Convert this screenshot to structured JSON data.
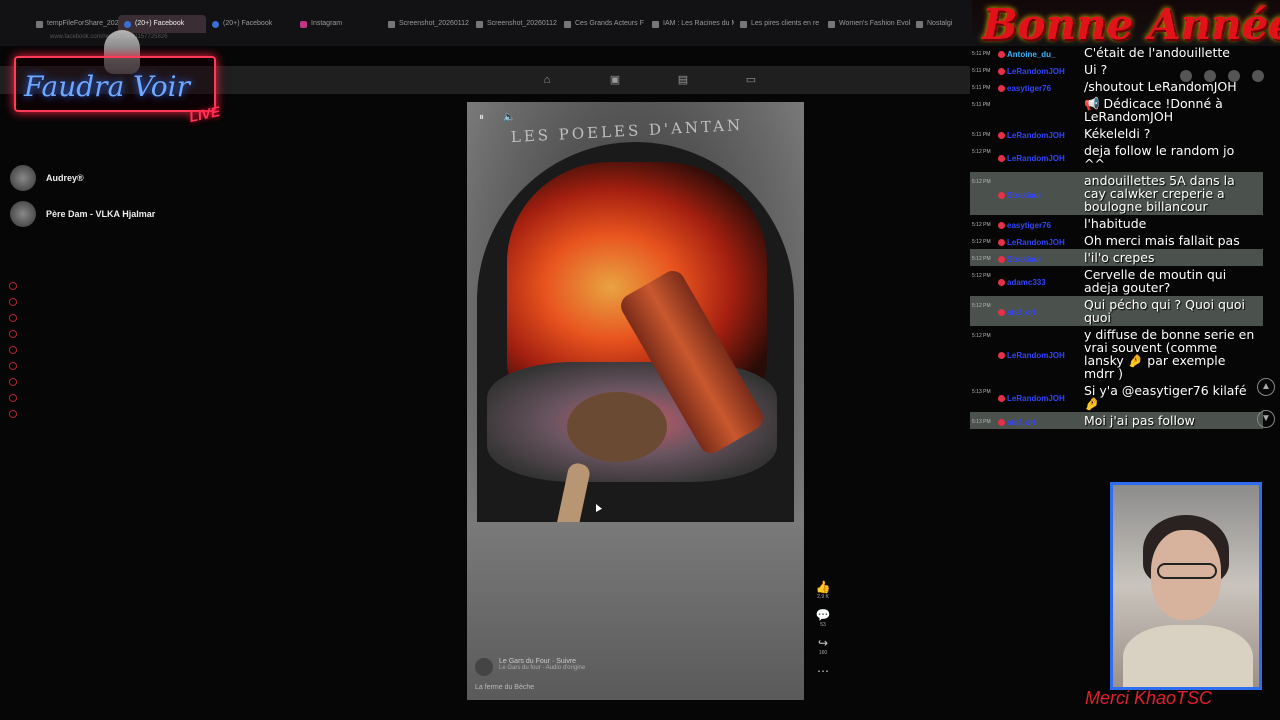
{
  "browser": {
    "tabs": [
      {
        "label": "tempFileForShare_2024",
        "icon": "doc-icon"
      },
      {
        "label": "(20+) Facebook",
        "icon": "facebook-icon",
        "active": true
      },
      {
        "label": "(20+) Facebook",
        "icon": "facebook-icon"
      },
      {
        "label": "Instagram",
        "icon": "instagram-icon"
      },
      {
        "label": "Screenshot_20260112",
        "icon": "doc-icon"
      },
      {
        "label": "Screenshot_20260112",
        "icon": "doc-icon"
      },
      {
        "label": "Ces Grands Acteurs F",
        "icon": "doc-icon"
      },
      {
        "label": "IAM : Les Racines du M",
        "icon": "doc-icon"
      },
      {
        "label": "Les pires clients en re",
        "icon": "doc-icon"
      },
      {
        "label": "Women's Fashion Evol",
        "icon": "doc-icon"
      },
      {
        "label": "Nostalgi",
        "icon": "doc-icon"
      }
    ],
    "url": "www.facebook.com/reel/1176691157725826"
  },
  "overlay": {
    "logo_text": "Faudra Voir",
    "logo_live": "LIVE",
    "banner_text": "Bonne Année",
    "bottom_text": "Merci KhaoTSC"
  },
  "sidebar": {
    "contacts": [
      {
        "name": "Audrey®"
      },
      {
        "name": "Père Dam - VLKA Hjalmar"
      }
    ]
  },
  "video": {
    "brand": "LES POELES D'ANTAN",
    "author": "Le Gars du Four",
    "author_sub": "Le Gars du four · Audio d'origine",
    "follow": "Suivre",
    "caption": "La ferme du Bèche"
  },
  "reactions": [
    {
      "icon": "like-icon",
      "count": "2,9 K"
    },
    {
      "icon": "comment-icon",
      "count": "53"
    },
    {
      "icon": "share-icon",
      "count": "160"
    }
  ],
  "chat": [
    {
      "time": "5:11 PM",
      "user": "Antoine_du_",
      "text": "C'était de l'andouillette",
      "color": "#3ab4ff",
      "highlight": false
    },
    {
      "time": "5:11 PM",
      "user": "LeRandomJOH",
      "text": "Ui ?",
      "color": "#3344ff",
      "highlight": false
    },
    {
      "time": "5:11 PM",
      "user": "easytiger76",
      "text": "/shoutout LeRandomJOH",
      "color": "#3344ff",
      "highlight": false
    },
    {
      "time": "5:11 PM",
      "user": "",
      "text": "📢 Dédicace !Donné à LeRandomJOH",
      "color": "#ffffff",
      "highlight": false
    },
    {
      "time": "5:11 PM",
      "user": "LeRandomJOH",
      "text": "Kékeleldi ?",
      "color": "#3344ff",
      "highlight": false
    },
    {
      "time": "5:12 PM",
      "user": "LeRandomJOH",
      "text": "deja follow le random jo ^^",
      "color": "#3344ff",
      "highlight": false
    },
    {
      "time": "5:12 PM",
      "user": "Strakiaur",
      "text": "andouillettes 5A dans la cay calwker creperie a boulogne billancour",
      "color": "#3344ff",
      "highlight": true
    },
    {
      "time": "5:12 PM",
      "user": "easytiger76",
      "text": "l'habitude",
      "color": "#3344ff",
      "highlight": false
    },
    {
      "time": "5:12 PM",
      "user": "LeRandomJOH",
      "text": "Oh merci mais fallait pas",
      "color": "#3344ff",
      "highlight": false
    },
    {
      "time": "5:12 PM",
      "user": "Strakiaur",
      "text": "l'il'o crepes",
      "color": "#3344ff",
      "highlight": true
    },
    {
      "time": "5:12 PM",
      "user": "adamc333",
      "text": "Cervelle de moutin qui adeja gouter?",
      "color": "#3344ff",
      "highlight": false
    },
    {
      "time": "5:12 PM",
      "user": "staf_cri",
      "text": "Qui pécho qui ? Quoi quoi quoi",
      "color": "#3344ff",
      "highlight": true
    },
    {
      "time": "5:12 PM",
      "user": "LeRandomJOH",
      "text": "y diffuse de bonne serie en vrai souvent (comme lansky 🤌 par exemple mdrr )",
      "color": "#3344ff",
      "highlight": false
    },
    {
      "time": "5:13 PM",
      "user": "LeRandomJOH",
      "text": "Si y'a @easytiger76 kilafé 🤌",
      "color": "#3344ff",
      "highlight": false
    },
    {
      "time": "5:13 PM",
      "user": "staf_cri",
      "text": "Moi j'ai pas follow",
      "color": "#3344ff",
      "highlight": true
    }
  ]
}
